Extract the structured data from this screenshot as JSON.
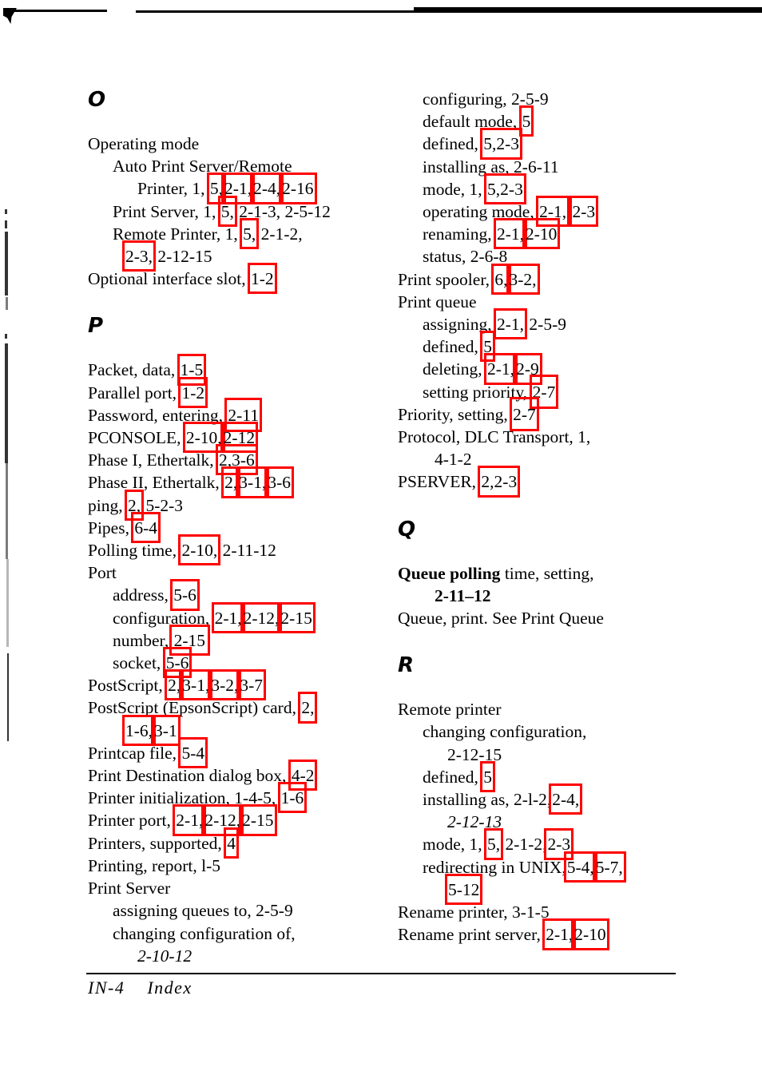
{
  "document": {
    "footer_page_label": "IN-4",
    "footer_section_label": "Index"
  },
  "left_column": {
    "section_o": {
      "letter": "O",
      "entries": [
        {
          "level": 1,
          "text": "Operating mode"
        },
        {
          "level": 2,
          "text": "Auto Print Server/Remote"
        },
        {
          "level": 3,
          "prefix": "Printer, 1,",
          "boxed": [
            "5,",
            "2-1,",
            "2-4,",
            "2-16"
          ]
        },
        {
          "level": 2,
          "prefix": "Print Server, 1,",
          "boxed": [
            "5,"
          ],
          "suffix": "2-1-3, 2-5-12"
        },
        {
          "level": 2,
          "prefix": "Remote Printer, 1,",
          "boxed": [
            "5,"
          ],
          "suffix": "2-1-2,"
        },
        {
          "level": 4,
          "boxed": [
            "2-3,"
          ],
          "suffix": "2-12-15"
        },
        {
          "level": 1,
          "prefix": "Optional interface slot,",
          "boxed": [
            "1-2"
          ]
        }
      ]
    },
    "section_p": {
      "letter": "P",
      "entries": [
        {
          "level": 1,
          "prefix": "Packet, data,",
          "boxed": [
            "1-5"
          ]
        },
        {
          "level": 1,
          "prefix": "Parallel port,",
          "boxed": [
            "1-2"
          ]
        },
        {
          "level": 1,
          "prefix": "Password, entering,",
          "boxed": [
            "2-11"
          ]
        },
        {
          "level": 1,
          "prefix": "PCONSOLE,",
          "boxed": [
            "2-10,",
            "2-12"
          ]
        },
        {
          "level": 1,
          "prefix": "Phase I, Ethertalk,",
          "boxed": [
            "2,",
            "3-6"
          ]
        },
        {
          "level": 1,
          "prefix": "Phase II, Ethertalk,",
          "boxed": [
            "2,",
            "3-1,",
            "3-6"
          ]
        },
        {
          "level": 1,
          "prefix": "ping,",
          "boxed": [
            "2,"
          ],
          "suffix": "5-2-3"
        },
        {
          "level": 1,
          "prefix": "Pipes,",
          "boxed": [
            "6-4"
          ]
        },
        {
          "level": 1,
          "prefix": "Polling time,",
          "boxed": [
            "2-10,"
          ],
          "suffix": "2-11-12"
        },
        {
          "level": 1,
          "text": "Port"
        },
        {
          "level": 2,
          "prefix": "address,",
          "boxed": [
            "5-6"
          ]
        },
        {
          "level": 2,
          "prefix": "configuration,",
          "boxed": [
            "2-1,",
            "2-12,",
            "2-15"
          ]
        },
        {
          "level": 2,
          "prefix": "number,",
          "boxed": [
            "2-15"
          ]
        },
        {
          "level": 2,
          "prefix": "socket,",
          "boxed": [
            "5-6"
          ]
        },
        {
          "level": 1,
          "prefix": "PostScript,",
          "boxed": [
            "2,",
            "3-1,",
            "3-2,",
            "3-7"
          ]
        },
        {
          "level": 1,
          "prefix": "PostScript (EpsonScript) card,",
          "boxed": [
            "2,"
          ]
        },
        {
          "level": 4,
          "boxed": [
            "1-6,",
            "3-1"
          ]
        },
        {
          "level": 1,
          "prefix": "Printcap file,",
          "boxed": [
            "5-4"
          ]
        },
        {
          "level": 1,
          "prefix": "Print Destination dialog box,",
          "boxed": [
            "4-2"
          ]
        },
        {
          "level": 1,
          "prefix": "Printer initialization, 1-4-5,",
          "boxed": [
            "1-6"
          ]
        },
        {
          "level": 1,
          "prefix": "Printer port,",
          "boxed": [
            "2-1,",
            "2-12,",
            "2-15"
          ]
        },
        {
          "level": 1,
          "prefix": "Printers, supported,",
          "boxed": [
            "4"
          ]
        },
        {
          "level": 1,
          "text": "Printing, report, l-5"
        },
        {
          "level": 1,
          "text": "Print Server"
        },
        {
          "level": 2,
          "text": "assigning queues to, 2-5-9"
        },
        {
          "level": 2,
          "text": "changing configuration of,"
        },
        {
          "level": 3,
          "italic_text": "2-10-12"
        }
      ]
    }
  },
  "right_column": {
    "section_print_server_cont": {
      "entries": [
        {
          "level": 2,
          "text": "configuring, 2-5-9"
        },
        {
          "level": 2,
          "prefix": "default  mode,",
          "boxed": [
            "5"
          ]
        },
        {
          "level": 2,
          "prefix": "defined,",
          "boxed": [
            "5,",
            "2-3"
          ]
        },
        {
          "level": 2,
          "text": "installing as, 2-6-11"
        },
        {
          "level": 2,
          "prefix": "mode, 1,",
          "boxed": [
            "5,",
            "2-3"
          ]
        },
        {
          "level": 2,
          "prefix": "operating  mode,",
          "boxed": [
            "2-1,",
            "2-3"
          ]
        },
        {
          "level": 2,
          "prefix": "renaming,",
          "boxed": [
            "2-1,",
            "2-10"
          ]
        },
        {
          "level": 2,
          "text": "status, 2-6-8"
        },
        {
          "level": 1,
          "prefix": "Print spooler,",
          "boxed": [
            "6,",
            "3-2,"
          ]
        },
        {
          "level": 1,
          "text": "Print queue"
        },
        {
          "level": 2,
          "prefix": "assigning,",
          "boxed": [
            "2-1,"
          ],
          "suffix": "2-5-9"
        },
        {
          "level": 2,
          "prefix": "defined,",
          "boxed": [
            "5"
          ]
        },
        {
          "level": 2,
          "prefix": "deleting,",
          "boxed": [
            "2-1,",
            "2-9"
          ]
        },
        {
          "level": 2,
          "prefix": "setting priority,",
          "boxed": [
            "2-7"
          ]
        },
        {
          "level": 1,
          "prefix": "Priority, setting,",
          "boxed": [
            "2-7"
          ]
        },
        {
          "level": 1,
          "text": "Protocol, DLC Transport, 1,"
        },
        {
          "level": 4,
          "text": "4-1-2"
        },
        {
          "level": 1,
          "prefix": "PSERVER,",
          "boxed": [
            "2,",
            "2-3"
          ]
        }
      ]
    },
    "section_q": {
      "letter": "Q",
      "entries": [
        {
          "level": 1,
          "bold_prefix": "Queue polling",
          "text_after_bold": " time, setting,"
        },
        {
          "level": 4,
          "bold_text": "2-11–12"
        },
        {
          "level": 1,
          "text": "Queue,  print. See  Print  Queue"
        }
      ]
    },
    "section_r": {
      "letter": "R",
      "entries": [
        {
          "level": 1,
          "text": "Remote printer"
        },
        {
          "level": 2,
          "text": "changing configuration,"
        },
        {
          "level": 3,
          "text": "2-12-15"
        },
        {
          "level": 2,
          "prefix": "defined,",
          "boxed": [
            "5"
          ]
        },
        {
          "level": 2,
          "prefix": "installing  as,  2-l-2,",
          "boxed": [
            "2-4,"
          ]
        },
        {
          "level": 3,
          "italic_text": "2-12-13"
        },
        {
          "level": 2,
          "prefix": "mode, 1,",
          "boxed": [
            "5,"
          ],
          "mid": "2-1-2,",
          "boxed2": [
            "2-3"
          ]
        },
        {
          "level": 2,
          "prefix": "redirecting in UNIX,",
          "boxed": [
            "5-4,",
            "5-7,"
          ]
        },
        {
          "level": 3,
          "boxed": [
            "5-12"
          ]
        },
        {
          "level": 1,
          "text": "Rename printer, 3-1-5"
        },
        {
          "level": 1,
          "prefix": "Rename  print  server,",
          "boxed": [
            "2-1,",
            "2-10"
          ]
        }
      ]
    }
  },
  "colors": {
    "annotation_box": "#ff0000",
    "text": "#000000",
    "page_background": "#ffffff"
  }
}
